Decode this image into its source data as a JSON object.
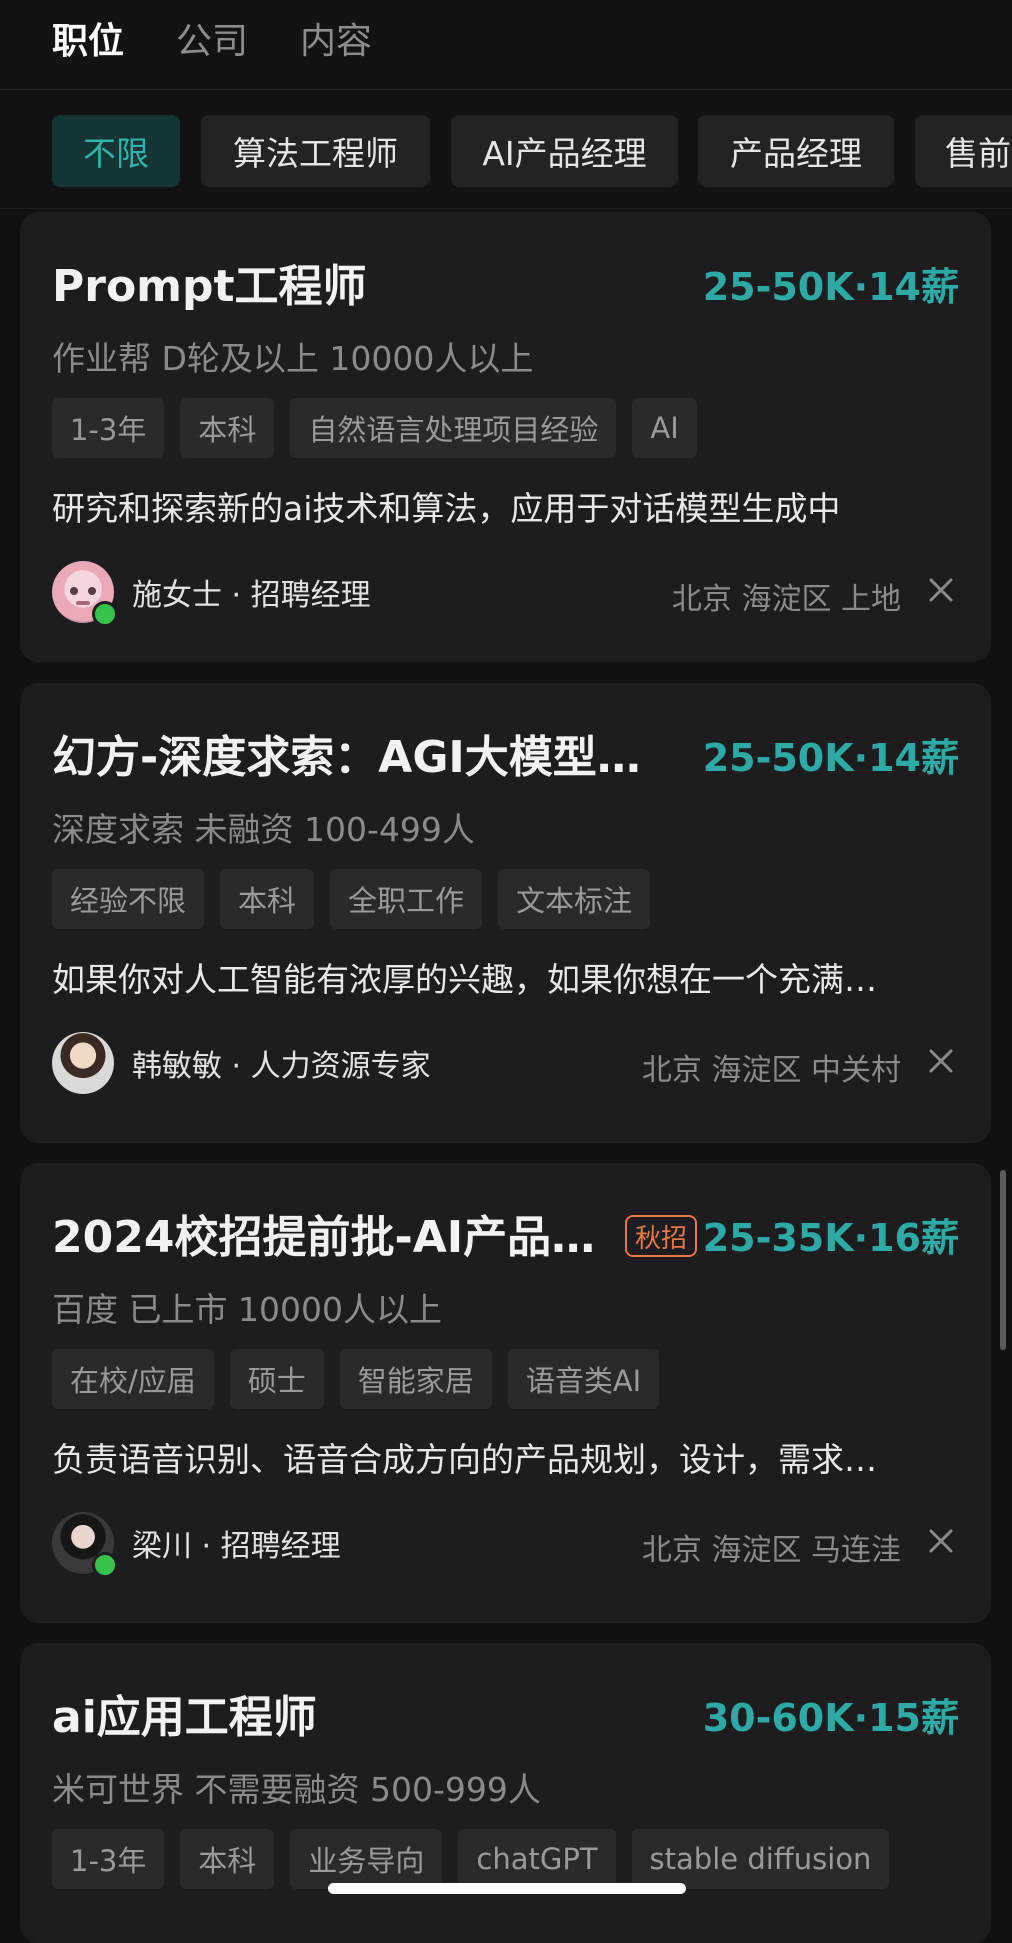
{
  "top_tabs": [
    {
      "label": "职位"
    },
    {
      "label": "公司"
    },
    {
      "label": "内容"
    }
  ],
  "filters": [
    "不限",
    "算法工程师",
    "AI产品经理",
    "产品经理",
    "售前"
  ],
  "colors": {
    "accent": "#2eaaa6",
    "campus_badge": "#e9774a",
    "online": "#36c24b",
    "background": "#111112",
    "card": "#1d1d1f"
  },
  "jobs": [
    {
      "title": "Prompt工程师",
      "salary": "25-50K·14薪",
      "company": "作业帮 D轮及以上 10000人以上",
      "tags": [
        "1-3年",
        "本科",
        "自然语言处理项目经验",
        "AI"
      ],
      "description": "研究和探索新的ai技术和算法，应用于对话模型生成中",
      "recruiter": "施女士 · 招聘经理",
      "location": "北京 海淀区 上地",
      "online": true
    },
    {
      "title": "幻方-深度求索：AGI大模型…",
      "salary": "25-50K·14薪",
      "company": "深度求索 未融资 100-499人",
      "tags": [
        "经验不限",
        "本科",
        "全职工作",
        "文本标注"
      ],
      "description": "如果你对人工智能有浓厚的兴趣，如果你想在一个充满…",
      "recruiter": "韩敏敏 · 人力资源专家",
      "location": "北京 海淀区 中关村",
      "online": false
    },
    {
      "title": "2024校招提前批-AI产品…",
      "badge": "秋招",
      "salary": "25-35K·16薪",
      "company": "百度 已上市 10000人以上",
      "tags": [
        "在校/应届",
        "硕士",
        "智能家居",
        "语音类AI"
      ],
      "description": "负责语音识别、语音合成方向的产品规划，设计，需求…",
      "recruiter": "梁川 · 招聘经理",
      "location": "北京 海淀区 马连洼",
      "online": true
    },
    {
      "title": "ai应用工程师",
      "salary": "30-60K·15薪",
      "company": "米可世界 不需要融资 500-999人",
      "tags": [
        "1-3年",
        "本科",
        "业务导向",
        "chatGPT",
        "stable diffusion"
      ]
    }
  ]
}
